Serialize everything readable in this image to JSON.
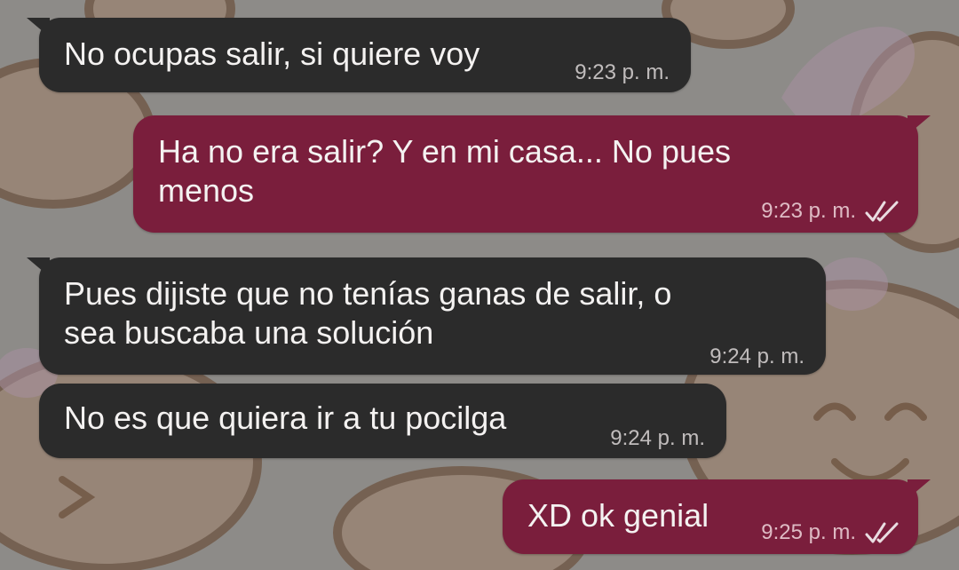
{
  "chat": {
    "messages": [
      {
        "direction": "incoming",
        "text": "No ocupas salir, si quiere voy",
        "time": "9:23 p. m."
      },
      {
        "direction": "outgoing",
        "lines": [
          "Ha no era salir? Y en mi casa... No pues",
          "menos"
        ],
        "time": "9:23 p. m.",
        "status_icon": "double-check-icon"
      },
      {
        "direction": "incoming",
        "lines": [
          "Pues dijiste que no tenías ganas de salir, o",
          "sea buscaba una solución"
        ],
        "time": "9:24 p. m."
      },
      {
        "direction": "incoming",
        "text": "No es que quiera ir a tu pocilga",
        "time": "9:24 p. m."
      },
      {
        "direction": "outgoing",
        "text": "XD ok genial",
        "time": "9:25 p. m.",
        "status_icon": "double-check-icon"
      }
    ]
  },
  "colors": {
    "incoming_bubble": "#2b2b2b",
    "outgoing_bubble": "#7a1e3c",
    "wallpaper": "#8d8b88"
  }
}
